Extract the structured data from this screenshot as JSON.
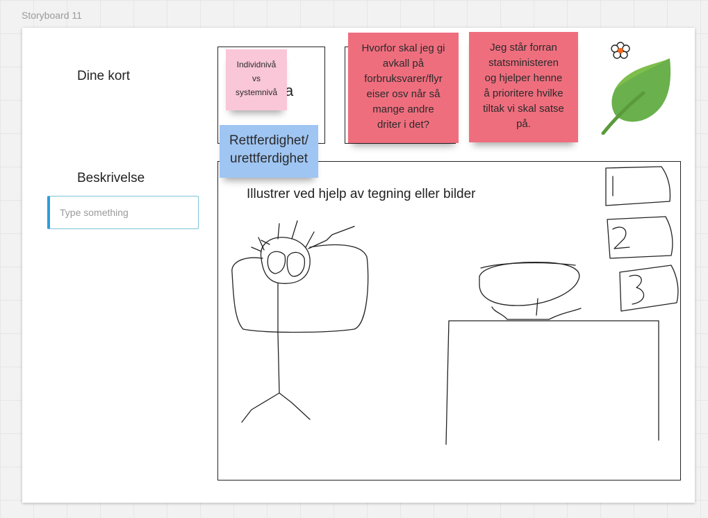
{
  "board": {
    "title": "Storyboard 11"
  },
  "left_panel": {
    "cards_label": "Dine kort",
    "description_label": "Beskrivelse",
    "description_placeholder": "Type something"
  },
  "cards": {
    "card1_peek_text": "a",
    "sticky_pink": {
      "line1": "Individnivå",
      "line2": "vs",
      "line3": "systemnivå"
    },
    "sticky_red_1": {
      "line1": "Hvorfor skal jeg gi",
      "line2": "avkall på",
      "line3": "forbruksvarer/flyr",
      "line4": "eiser osv når så",
      "line5": "mange andre",
      "line6": "driter i det?"
    },
    "sticky_red_2": {
      "line1": "Jeg står forran",
      "line2": "statsministeren",
      "line3": "og hjelper henne",
      "line4": "å prioritere hvilke",
      "line5": "tiltak vi skal satse",
      "line6": "på."
    },
    "sticky_blue": {
      "line1": "Rettferdighet/",
      "line2": "urettferdighet"
    }
  },
  "canvas": {
    "instruction": "Illustrer ved hjelp av tegning eller bilder"
  },
  "colors": {
    "sticky_pink": "#f9c7d8",
    "sticky_red": "#ef6e7e",
    "sticky_blue": "#9fc5f2",
    "input_accent": "#2d9cdb",
    "leaf": "#6ab04c"
  },
  "icons": [
    "flower-icon",
    "leaf-icon"
  ]
}
